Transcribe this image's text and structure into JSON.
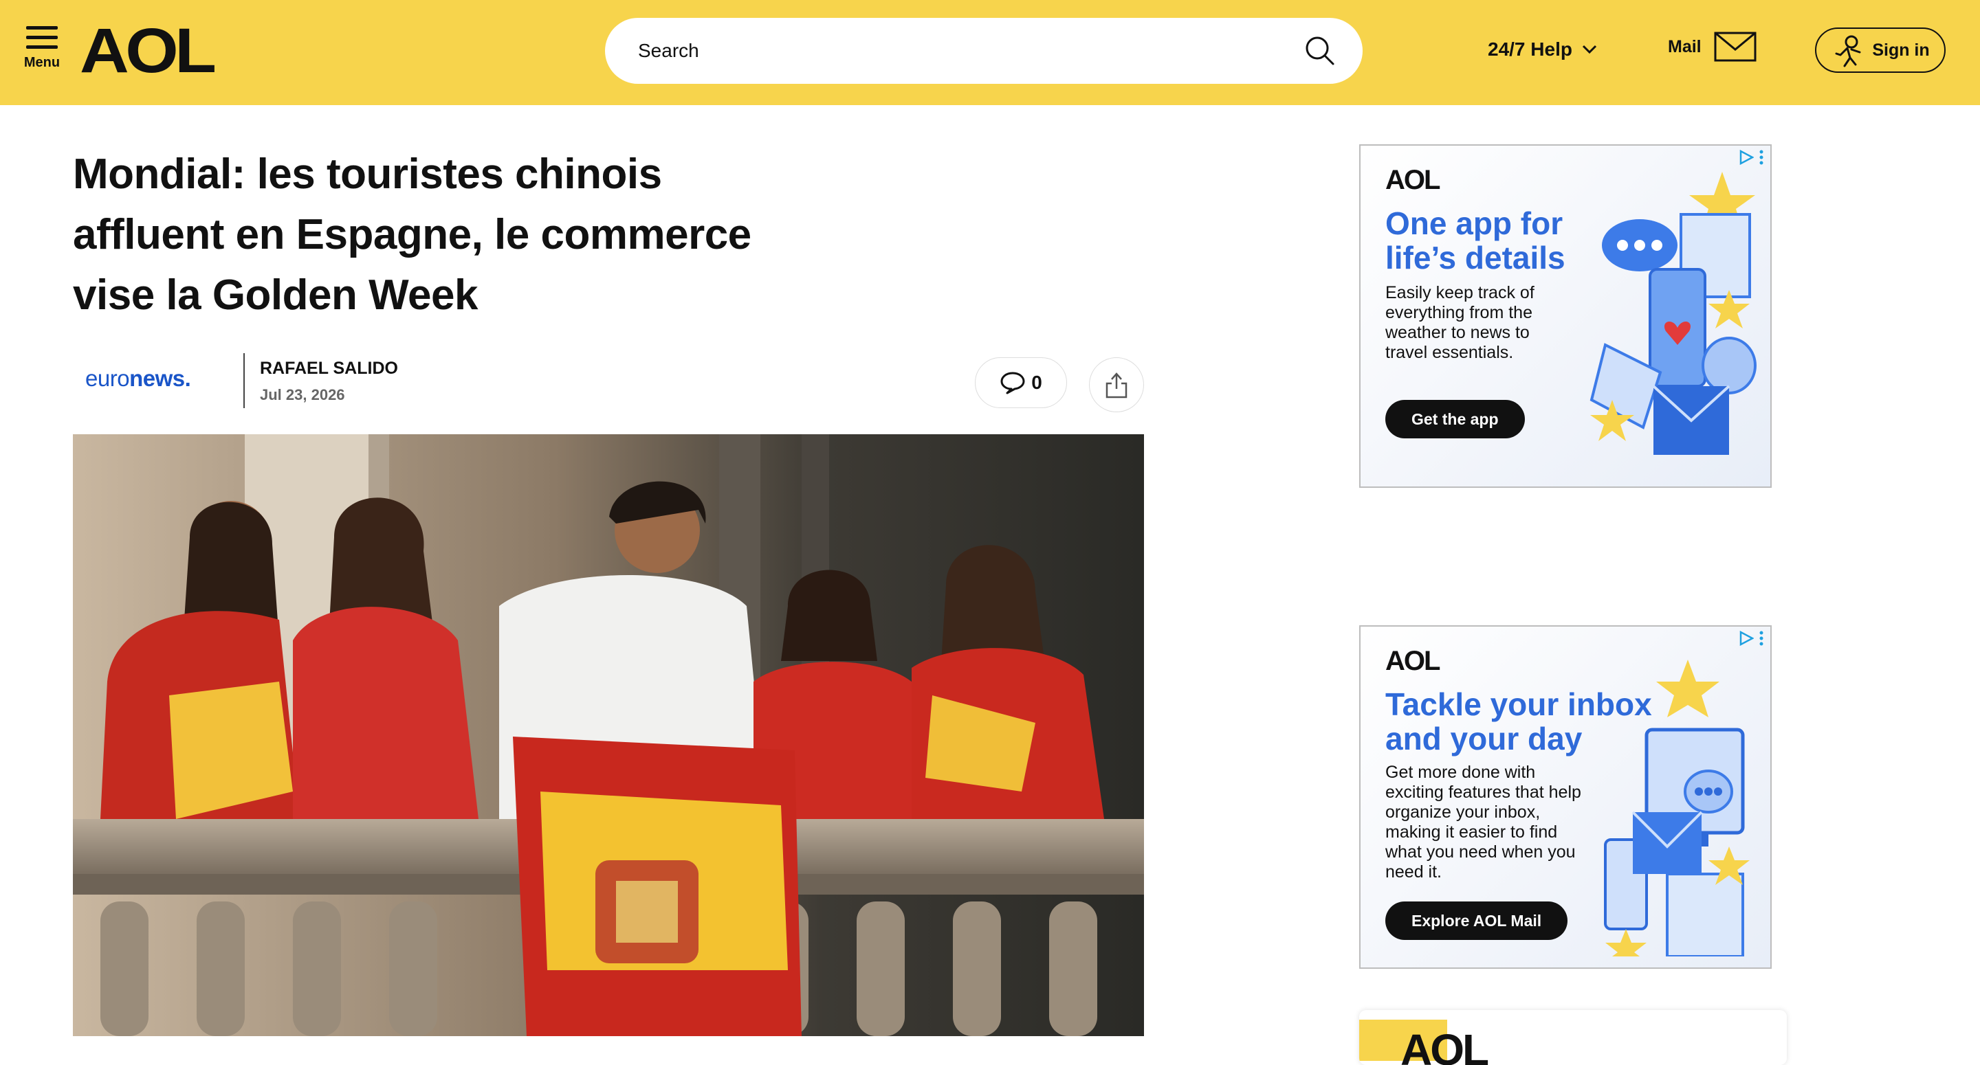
{
  "header": {
    "menu_label": "Menu",
    "logo": "AOL",
    "search_placeholder": "Search",
    "help_label": "24/7 Help",
    "mail_label": "Mail",
    "signin_label": "Sign in"
  },
  "article": {
    "headline": "Mondial: les touristes chinois affluent en Espagne, le commerce vise la Golden Week",
    "source": {
      "prefix": "euro",
      "suffix": "news."
    },
    "author": "RAFAEL SALIDO",
    "date": "Jul 23, 2026",
    "comment_count": "0",
    "photo_icon": "photo-fans-spain-flag"
  },
  "ads": [
    {
      "logo": "AOL",
      "title": "One app for life’s details",
      "body": "Easily keep track of everything from the weather to news to travel essentials.",
      "cta": "Get the app"
    },
    {
      "logo": "AOL",
      "title": "Tackle your inbox and your day",
      "body": "Get more done with exciting features that help organize your inbox, making it easier to find what you need when you need it.",
      "cta": "Explore AOL Mail"
    }
  ],
  "bottom_ad": {
    "logo": "AOL"
  },
  "colors": {
    "brand_yellow": "#f7d44c",
    "ad_blue": "#2f6ad9",
    "source_blue": "#1a55c8"
  }
}
